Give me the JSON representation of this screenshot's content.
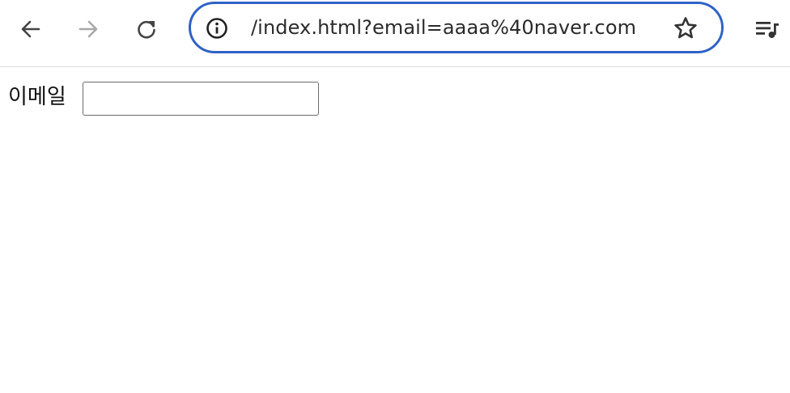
{
  "browser": {
    "toolbar": {
      "back_icon": "arrow-left-icon",
      "forward_icon": "arrow-right-icon",
      "forward_enabled": false,
      "reload_icon": "reload-icon",
      "media_icon": "media-queue-icon"
    },
    "omnibox": {
      "site_info_icon": "info-icon",
      "url": "/index.html?email=aaaa%40naver.com",
      "bookmark_icon": "star-outline-icon",
      "focus_color": "#2f62c6"
    }
  },
  "form": {
    "email_label": "이메일",
    "email_value": ""
  }
}
